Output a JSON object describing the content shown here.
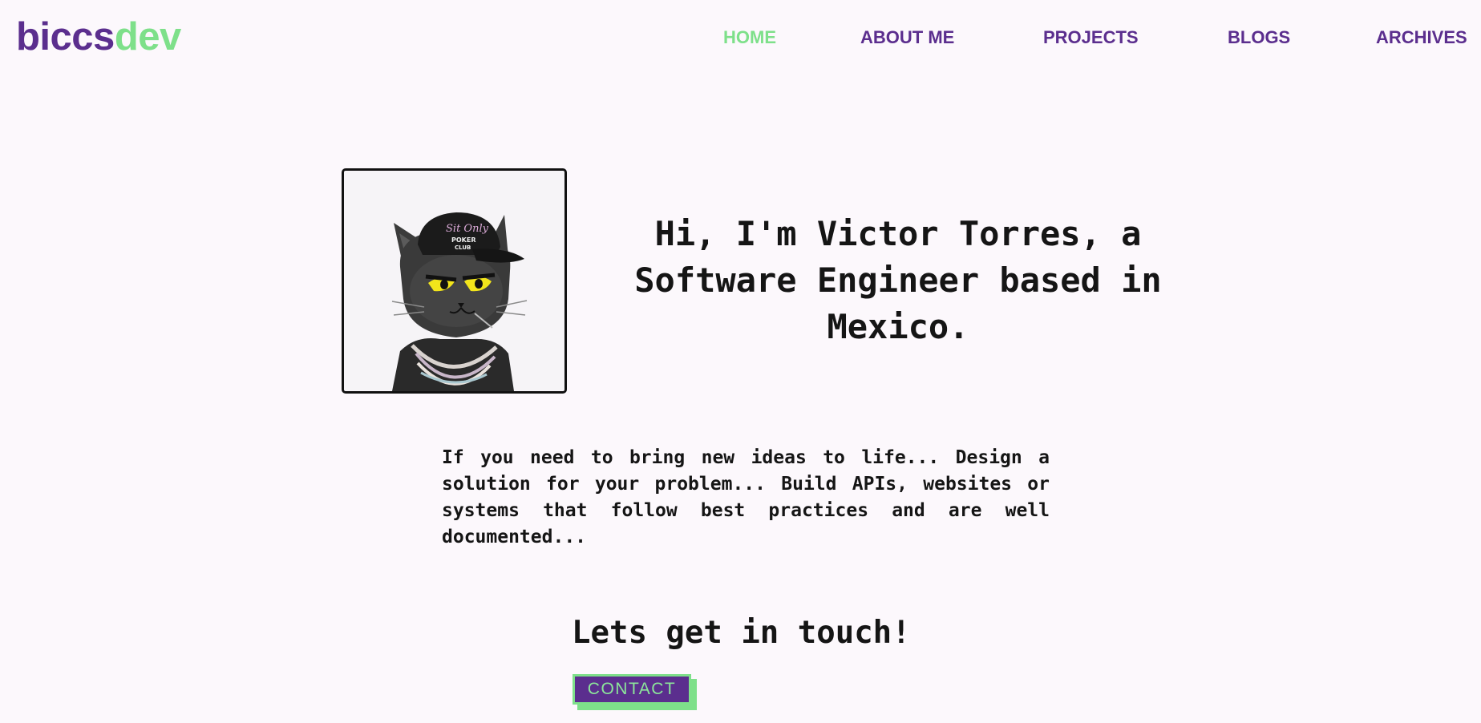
{
  "header": {
    "logo": {
      "part1": "biccs",
      "part2": "dev"
    },
    "nav": [
      {
        "label": "HOME",
        "active": true
      },
      {
        "label": "ABOUT ME",
        "active": false
      },
      {
        "label": "PROJECTS",
        "active": false
      },
      {
        "label": "BLOGS",
        "active": false
      },
      {
        "label": "ARCHIVES",
        "active": false
      }
    ]
  },
  "hero": {
    "avatar_icon": "black-cat-with-cap-avatar",
    "title": "Hi, I'm Victor Torres, a Software Engineer based in Mexico.",
    "intro": "If you need to bring new ideas to life... Design a solution for your problem... Build APIs, websites or systems that follow best practices and are well documented...",
    "cta_heading": "Lets get in touch!",
    "contact_label": "CONTACT"
  },
  "colors": {
    "background": "#fcf8fc",
    "brand_purple": "#5b2e8e",
    "brand_green": "#7ee08a",
    "text": "#151515"
  }
}
